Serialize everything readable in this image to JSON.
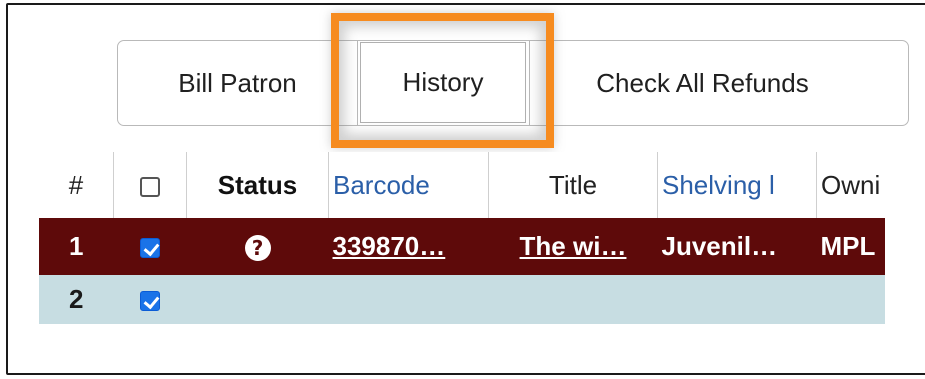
{
  "toolbar": {
    "bill_patron": "Bill Patron",
    "history": "History",
    "check_all_refunds": "Check All Refunds"
  },
  "highlight_color": "#f68b1f",
  "table": {
    "headers": {
      "num": "#",
      "status": "Status",
      "barcode": "Barcode",
      "title": "Title",
      "shelving": "Shelving l",
      "owning": "Owni"
    },
    "rows": [
      {
        "num": "1",
        "checked": true,
        "status_icon": "question-icon",
        "status_glyph": "?",
        "barcode": "339870…",
        "title": "The wi…",
        "shelving": "Juvenil…",
        "owning": "MPL",
        "row_color": "#5e0a0a"
      },
      {
        "num": "2",
        "checked": true,
        "barcode": "",
        "title": "",
        "shelving": "",
        "owning": "",
        "row_color": "#c7dde2"
      }
    ]
  }
}
